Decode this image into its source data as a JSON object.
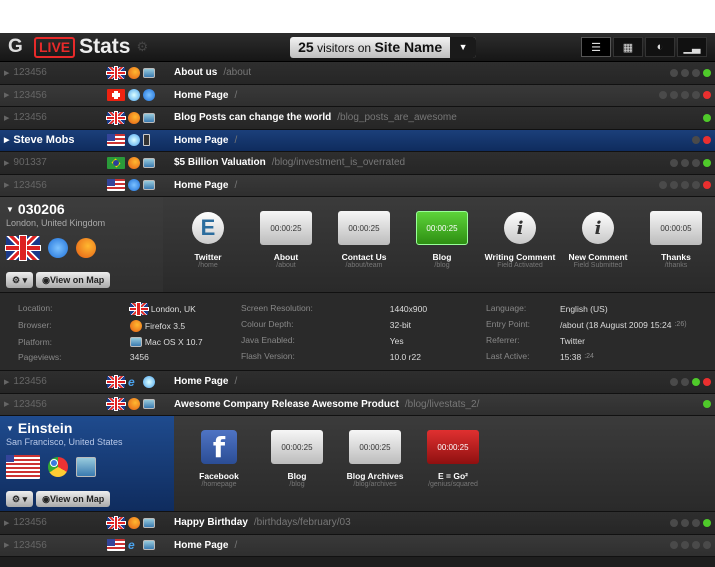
{
  "header": {
    "logo_g": "G",
    "live": "LIVE",
    "stats": "Stats",
    "visitor_count": "25",
    "visitors_label": "visitors on",
    "site_name": "Site Name"
  },
  "rows_top": [
    {
      "id": "123456",
      "flag": "uk",
      "browser": "ff",
      "os": "mac",
      "title": "About us",
      "path": "/about",
      "dots": [
        "n",
        "n",
        "n",
        "g"
      ]
    },
    {
      "id": "123456",
      "flag": "ch",
      "browser": "sf",
      "os": "ie",
      "title": "Home Page",
      "path": "/",
      "dots": [
        "n",
        "n",
        "n",
        "n",
        "r"
      ]
    },
    {
      "id": "123456",
      "flag": "uk",
      "browser": "ff",
      "os": "mac",
      "title": "Blog Posts can change the world",
      "path": "/blog_posts_are_awesome",
      "dots": [
        "g"
      ]
    },
    {
      "id": "Steve Mobs",
      "flag": "us",
      "browser": "sf",
      "os": "phone",
      "title": "Home Page",
      "path": "/",
      "dots": [
        "n",
        "r"
      ],
      "selected": true
    },
    {
      "id": "901337",
      "flag": "br",
      "browser": "ff",
      "os": "mac",
      "title": "$5 Billion Valuation",
      "path": "/blog/investment_is_overrated",
      "dots": [
        "n",
        "n",
        "n",
        "g"
      ]
    },
    {
      "id": "123456",
      "flag": "us",
      "browser": "ie",
      "os": "mac",
      "title": "Home Page",
      "path": "/",
      "dots": [
        "n",
        "n",
        "n",
        "n",
        "r"
      ]
    }
  ],
  "expanded1": {
    "id": "030206",
    "location": "London, United Kingdom",
    "map_button": "View on Map",
    "steps": [
      {
        "kind": "tw",
        "glyph": "E",
        "label": "Twitter",
        "sub": "/home"
      },
      {
        "kind": "box",
        "time": "00:00:25",
        "label": "About",
        "sub": "/about"
      },
      {
        "kind": "box",
        "time": "00:00:25",
        "label": "Contact Us",
        "sub": "/about/team"
      },
      {
        "kind": "green",
        "time": "00:00:25",
        "label": "Blog",
        "sub": "/blog"
      },
      {
        "kind": "circ",
        "glyph": "i",
        "label": "Writing Comment",
        "sub": "Field Activated"
      },
      {
        "kind": "circ",
        "glyph": "i",
        "label": "New Comment",
        "sub": "Field Submitted"
      },
      {
        "kind": "box",
        "time": "00:00:05",
        "label": "Thanks",
        "sub": "/thanks"
      }
    ]
  },
  "details": {
    "col1": [
      [
        "Location:",
        "London, UK"
      ],
      [
        "Browser:",
        "Firefox 3.5"
      ],
      [
        "Platform:",
        "Mac OS X 10.7"
      ],
      [
        "Pageviews:",
        "3456"
      ]
    ],
    "col2": [
      [
        "Screen Resolution:",
        "1440x900"
      ],
      [
        "Colour Depth:",
        "32-bit"
      ],
      [
        "Java Enabled:",
        "Yes"
      ],
      [
        "Flash Version:",
        "10.0 r22"
      ]
    ],
    "col3": [
      [
        "Language:",
        "English (US)"
      ],
      [
        "Entry Point:",
        "/about (18 August 2009 15:24",
        ":26)"
      ],
      [
        "Referrer:",
        "Twitter"
      ],
      [
        "Last Active:",
        "15:38",
        ":24"
      ]
    ]
  },
  "rows_mid": [
    {
      "id": "123456",
      "flag": "uk",
      "browser": "iee",
      "os": "sf",
      "title": "Home Page",
      "path": "/",
      "dots": [
        "n",
        "n",
        "g",
        "r"
      ]
    },
    {
      "id": "123456",
      "flag": "uk",
      "browser": "ff",
      "os": "mac",
      "title": "Awesome Company Release Awesome Product",
      "path": "/blog/livestats_2/",
      "dots": [
        "g"
      ]
    }
  ],
  "expanded2": {
    "id": "Einstein",
    "location": "San Francisco, United States",
    "map_button": "View on Map",
    "steps": [
      {
        "kind": "fb",
        "glyph": "f",
        "label": "Facebook",
        "sub": "/homepage"
      },
      {
        "kind": "box",
        "time": "00:00:25",
        "label": "Blog",
        "sub": "/blog"
      },
      {
        "kind": "box",
        "time": "00:00:25",
        "label": "Blog Archives",
        "sub": "/blog/archives"
      },
      {
        "kind": "red",
        "time": "00:00:25",
        "label": "E = Go²",
        "sub": "/genius/squared"
      }
    ]
  },
  "rows_bottom": [
    {
      "id": "123456",
      "flag": "uk",
      "browser": "ff",
      "os": "mac",
      "title": "Happy Birthday",
      "path": "/birthdays/february/03",
      "dots": [
        "n",
        "n",
        "n",
        "g"
      ]
    },
    {
      "id": "123456",
      "flag": "us",
      "browser": "iee",
      "os": "mac",
      "title": "Home Page",
      "path": "/",
      "dots": [
        "n",
        "n",
        "n",
        "n"
      ]
    }
  ]
}
